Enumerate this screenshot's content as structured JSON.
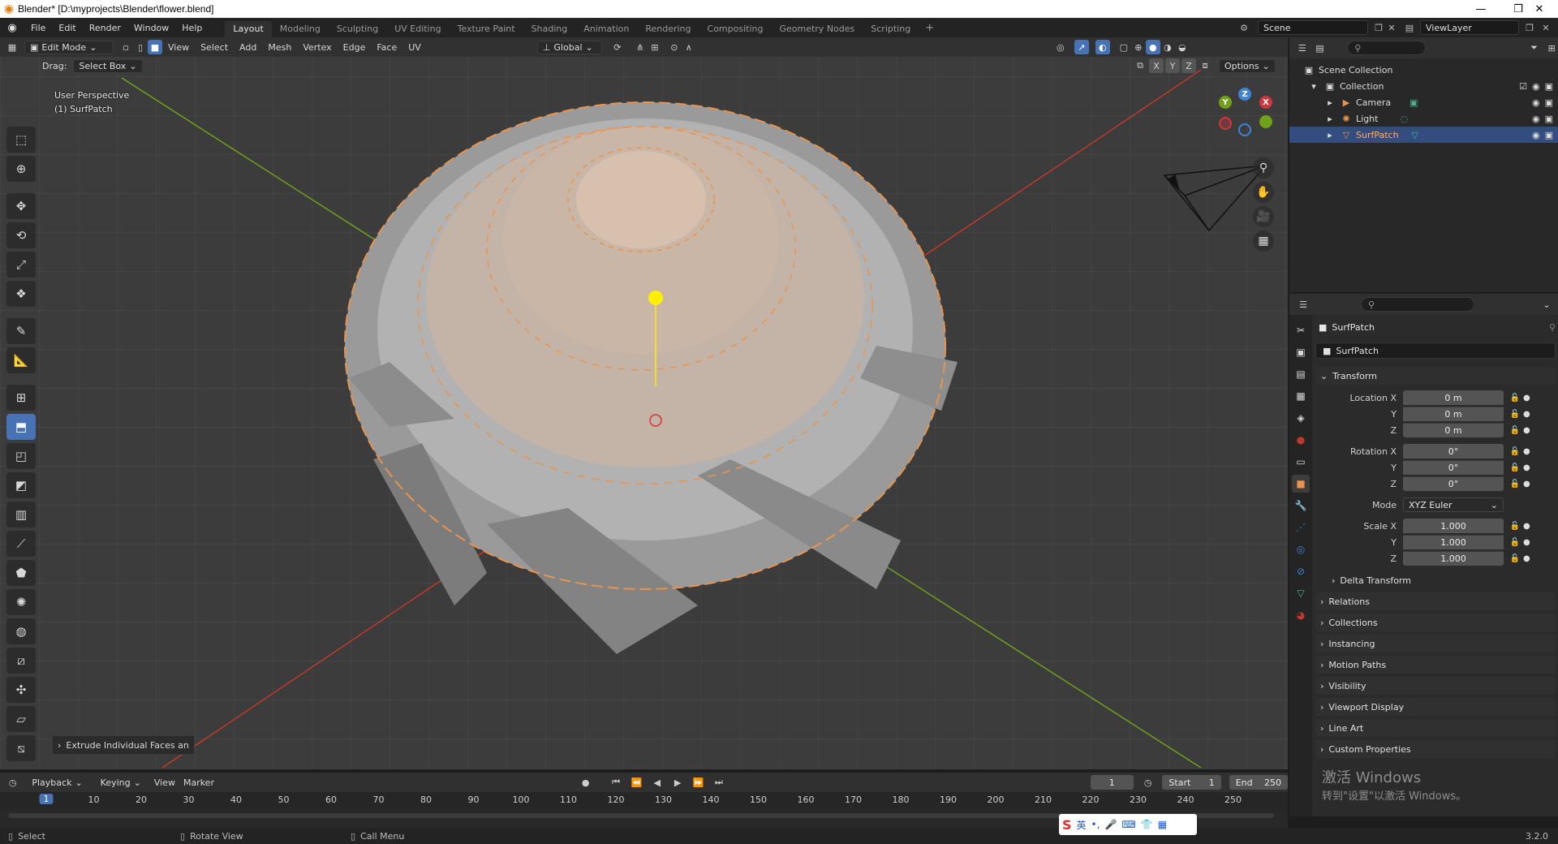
{
  "window": {
    "title": "Blender* [D:\\myprojects\\Blender\\flower.blend]",
    "controls": [
      "—",
      "❐",
      "✕"
    ]
  },
  "menu": {
    "items": [
      "File",
      "Edit",
      "Render",
      "Window",
      "Help"
    ],
    "workspaces": [
      "Layout",
      "Modeling",
      "Sculpting",
      "UV Editing",
      "Texture Paint",
      "Shading",
      "Animation",
      "Rendering",
      "Compositing",
      "Geometry Nodes",
      "Scripting"
    ],
    "active_workspace": "Layout",
    "add_tab": "+",
    "scene": "Scene",
    "view_layer": "ViewLayer"
  },
  "viewport": {
    "mode": "Edit Mode",
    "menus": [
      "View",
      "Select",
      "Add",
      "Mesh",
      "Vertex",
      "Edge",
      "Face",
      "UV"
    ],
    "transform_orientation": "Global",
    "drag_label": "Drag:",
    "drag_value": "Select Box",
    "axes": [
      "X",
      "Y",
      "Z"
    ],
    "options": "Options",
    "overlay_line1": "User Perspective",
    "overlay_line2": "(1) SurfPatch",
    "gizmo": {
      "x": "X",
      "y": "Y",
      "z": "Z"
    },
    "last_operator": "Extrude Individual Faces an",
    "colors": {
      "x_axis": "#c0392b",
      "y_axis": "#6fa11a",
      "accent": "#4772b3",
      "mesh_edge": "#e8944e",
      "light": "#ffee00"
    }
  },
  "toolbar": {
    "tools": [
      "select-box",
      "cursor",
      "move",
      "rotate",
      "scale",
      "transform",
      "annotate",
      "measure",
      "add-cube",
      "extrude-region",
      "inset-faces",
      "bevel",
      "loop-cut",
      "knife",
      "poly-build",
      "spin",
      "smooth",
      "edge-slide",
      "shrink-fatten",
      "shear",
      "rip-region"
    ],
    "active_index": 9
  },
  "outliner": {
    "search_placeholder": "",
    "rows": [
      {
        "label": "Scene Collection",
        "icon": "collection-icon",
        "depth": 0
      },
      {
        "label": "Collection",
        "icon": "collection-icon",
        "depth": 1
      },
      {
        "label": "Camera",
        "icon": "camera-icon",
        "depth": 2
      },
      {
        "label": "Light",
        "icon": "light-icon",
        "depth": 2
      },
      {
        "label": "SurfPatch",
        "icon": "mesh-icon",
        "depth": 2,
        "selected": true
      }
    ]
  },
  "properties": {
    "object_name": "SurfPatch",
    "name_field": "SurfPatch",
    "transform_title": "Transform",
    "location": {
      "label_x": "Location X",
      "label_y": "Y",
      "label_z": "Z",
      "x": "0 m",
      "y": "0 m",
      "z": "0 m"
    },
    "rotation": {
      "label_x": "Rotation X",
      "label_y": "Y",
      "label_z": "Z",
      "x": "0°",
      "y": "0°",
      "z": "0°"
    },
    "mode_label": "Mode",
    "mode_value": "XYZ Euler",
    "scale": {
      "label_x": "Scale X",
      "label_y": "Y",
      "label_z": "Z",
      "x": "1.000",
      "y": "1.000",
      "z": "1.000"
    },
    "delta_transform": "Delta Transform",
    "panels": [
      "Relations",
      "Collections",
      "Instancing",
      "Motion Paths",
      "Visibility",
      "Viewport Display",
      "Line Art",
      "Custom Properties"
    ]
  },
  "timeline": {
    "menus": [
      "Playback",
      "Keying",
      "View",
      "Marker"
    ],
    "current_frame": "1",
    "start_label": "Start",
    "start": "1",
    "end_label": "End",
    "end": "250",
    "ticks": [
      "1",
      "10",
      "20",
      "30",
      "40",
      "50",
      "60",
      "70",
      "80",
      "90",
      "100",
      "110",
      "120",
      "130",
      "140",
      "150",
      "160",
      "170",
      "180",
      "190",
      "200",
      "210",
      "220",
      "230",
      "240",
      "250"
    ]
  },
  "status": {
    "select": "Select",
    "rotate": "Rotate View",
    "menu": "Call Menu",
    "version": "3.2.0"
  },
  "ime": {
    "lang": "英"
  },
  "watermark": {
    "line1": "激活 Windows",
    "line2": "转到\"设置\"以激活 Windows。"
  }
}
